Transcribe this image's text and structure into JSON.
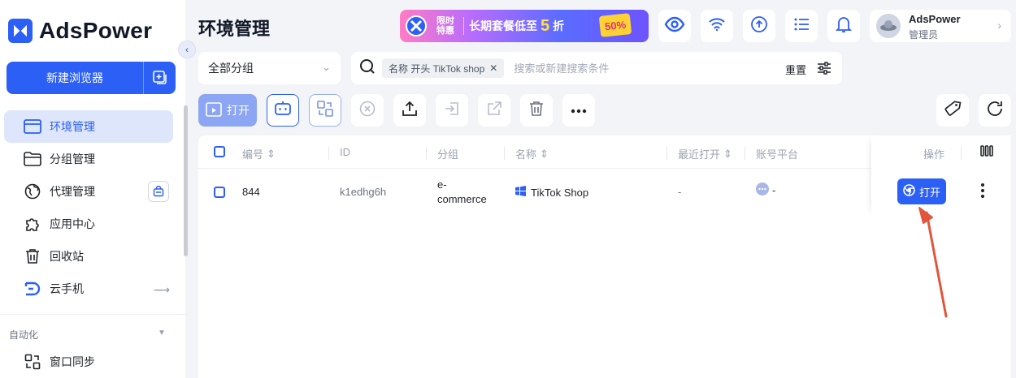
{
  "app": {
    "name": "AdsPower"
  },
  "sidebar": {
    "new_browser_label": "新建浏览器",
    "items": [
      {
        "label": "环境管理",
        "icon": "window-icon",
        "active": true
      },
      {
        "label": "分组管理",
        "icon": "folder-icon"
      },
      {
        "label": "代理管理",
        "icon": "globe-icon"
      },
      {
        "label": "应用中心",
        "icon": "puzzle-icon"
      },
      {
        "label": "回收站",
        "icon": "trash-icon"
      },
      {
        "label": "云手机",
        "icon": "cloud-phone-icon"
      }
    ],
    "section_label": "自动化",
    "sync_label": "窗口同步"
  },
  "header": {
    "title": "环境管理",
    "banner": {
      "tag_top": "限时",
      "tag_bottom": "特惠",
      "text": "长期套餐低至",
      "number": "5",
      "suffix": "折",
      "badge": "50%"
    },
    "user": {
      "name": "AdsPower",
      "role": "管理员"
    }
  },
  "filters": {
    "group_select": "全部分组",
    "chip_label": "名称 开头 TikTok shop",
    "search_placeholder": "搜索或新建搜索条件",
    "reset_label": "重置"
  },
  "toolbar": {
    "open_label": "打开"
  },
  "table": {
    "columns": [
      "编号",
      "ID",
      "分组",
      "名称",
      "最近打开",
      "账号平台",
      "操作"
    ],
    "rows": [
      {
        "serial": "844",
        "id": "k1edhg6h",
        "group_line1": "e-",
        "group_line2": "commerce",
        "name": "TikTok Shop",
        "last_open": "-",
        "platform": "-",
        "action": "打开"
      }
    ]
  },
  "colors": {
    "accent": "#2c5ff6",
    "annotation": "#e2553b"
  }
}
